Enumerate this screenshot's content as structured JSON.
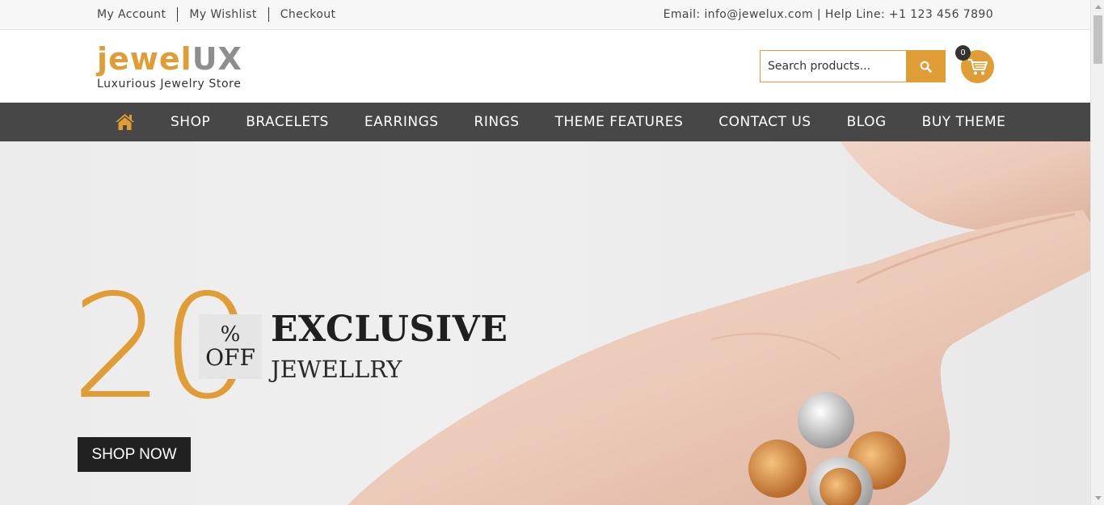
{
  "topbar": {
    "links": [
      "My Account",
      "My Wishlist",
      "Checkout"
    ],
    "contact": "Email: info@jewelux.com | Help Line: +1 123 456 7890"
  },
  "header": {
    "logo_part1": "jewel",
    "logo_part2": "UX",
    "tagline": "Luxurious Jewelry Store",
    "search_placeholder": "Search products...",
    "cart_count": "0"
  },
  "nav": {
    "items": [
      "SHOP",
      "BRACELETS",
      "EARRINGS",
      "RINGS",
      "THEME FEATURES",
      "CONTACT US",
      "BLOG",
      "BUY THEME"
    ]
  },
  "hero": {
    "promo_number": "20",
    "percent": "%",
    "off": "OFF",
    "title": "EXCLUSIVE",
    "subtitle": "JEWELLRY",
    "cta": "SHOP NOW"
  },
  "colors": {
    "accent": "#e09c35",
    "nav_bg": "#474747",
    "dark": "#212121",
    "logo_grey": "#8e8e8e"
  },
  "icons": [
    "search-icon",
    "cart-icon",
    "home-icon",
    "scroll-up-icon",
    "scroll-down-icon"
  ]
}
